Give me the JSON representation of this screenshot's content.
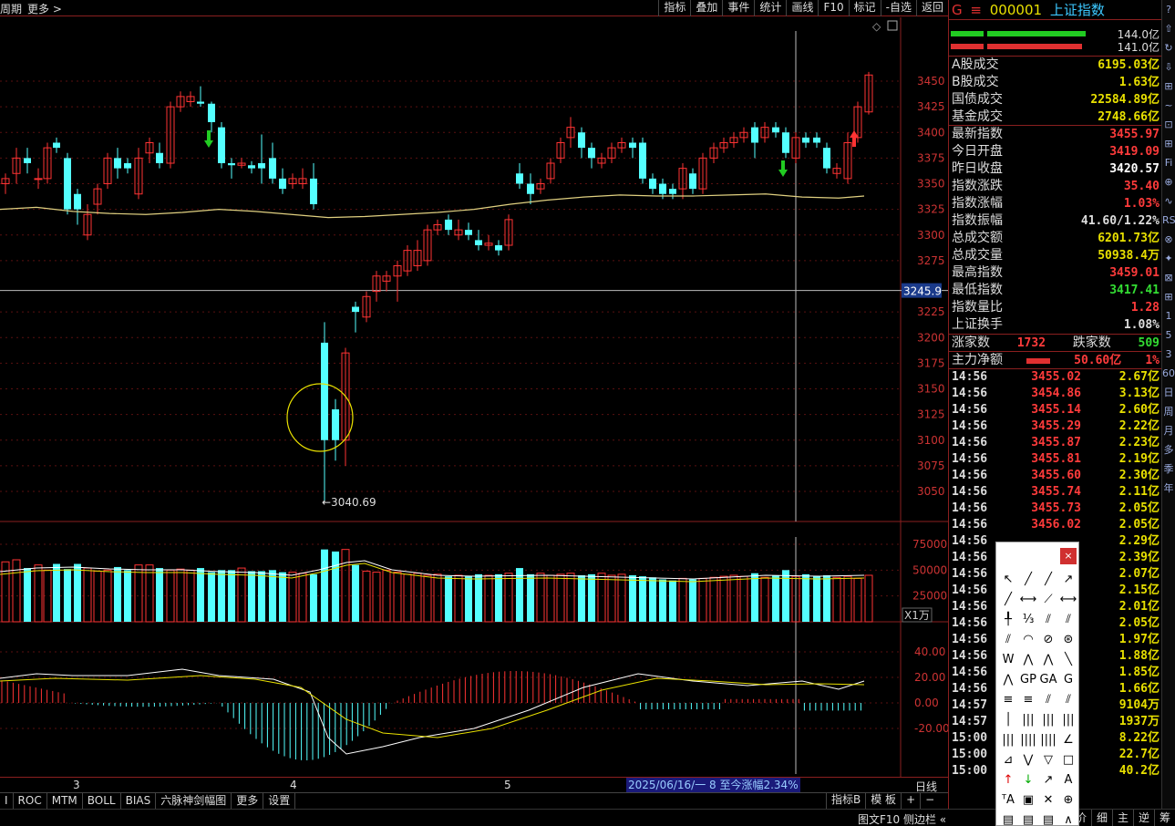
{
  "topbar": {
    "left": [
      "周期",
      "更多 >"
    ],
    "buttons": [
      "指标",
      "叠加",
      "事件",
      "统计",
      "画线",
      "F10",
      "标记",
      "-自选",
      "返回"
    ]
  },
  "price_chart": {
    "y_ticks": [
      "3450",
      "3425",
      "3400",
      "3375",
      "3350",
      "3325",
      "3300",
      "3275",
      "3245.9",
      "3225",
      "3200",
      "3175",
      "3150",
      "3125",
      "3100",
      "3075",
      "3050"
    ],
    "low_label": "←3040.69",
    "crosshair_price": "3245.9"
  },
  "volume_chart": {
    "y_ticks": [
      "75000",
      "50000",
      "25000"
    ],
    "unit": "X1万"
  },
  "macd_chart": {
    "y_ticks": [
      "40.00",
      "20.00",
      "0.00",
      "-20.00"
    ]
  },
  "x_axis": {
    "months": [
      "3",
      "4",
      "5"
    ],
    "hint": "2025/06/16/一 8 至今涨幅2.34%",
    "right": "日线"
  },
  "tabs": [
    "I",
    "ROC",
    "MTM",
    "BOLL",
    "BIAS",
    "六脉神剑幅图",
    "更多",
    "设置"
  ],
  "tabs_right": [
    "指标B",
    "模 板",
    "+",
    "−"
  ],
  "status": {
    "left": "图文F10 侧边栏 «",
    "right": [
      "笔",
      "价",
      "细",
      "主",
      "逆",
      "筹"
    ]
  },
  "header": {
    "g": "G",
    "menu": "≡",
    "code": "000001",
    "name": "上证指数"
  },
  "flow_bars": {
    "up": "144.0亿",
    "down": "141.0亿"
  },
  "stats": [
    {
      "k": "A股成交",
      "v": "6195.03亿",
      "c": "#e8e000"
    },
    {
      "k": "B股成交",
      "v": "1.63亿",
      "c": "#e8e000"
    },
    {
      "k": "国债成交",
      "v": "22584.89亿",
      "c": "#e8e000"
    },
    {
      "k": "基金成交",
      "v": "2748.66亿",
      "c": "#e8e000"
    },
    {
      "k": "最新指数",
      "v": "3455.97",
      "c": "#ff3b3b"
    },
    {
      "k": "今日开盘",
      "v": "3419.09",
      "c": "#ff3b3b"
    },
    {
      "k": "昨日收盘",
      "v": "3420.57",
      "c": "#ffffff"
    },
    {
      "k": "指数涨跌",
      "v": "35.40",
      "c": "#ff3b3b"
    },
    {
      "k": "指数涨幅",
      "v": "1.03%",
      "c": "#ff3b3b"
    },
    {
      "k": "指数振幅",
      "v": "41.60/1.22%",
      "c": "#dddddd"
    },
    {
      "k": "总成交额",
      "v": "6201.73亿",
      "c": "#e8e000"
    },
    {
      "k": "总成交量",
      "v": "50938.4万",
      "c": "#e8e000"
    },
    {
      "k": "最高指数",
      "v": "3459.01",
      "c": "#ff3b3b"
    },
    {
      "k": "最低指数",
      "v": "3417.41",
      "c": "#33dd33"
    },
    {
      "k": "指数量比",
      "v": "1.28",
      "c": "#ff3b3b"
    },
    {
      "k": "上证换手",
      "v": "1.08%",
      "c": "#dddddd"
    }
  ],
  "breadth": {
    "up_label": "涨家数",
    "up": "1732",
    "down_label": "跌家数",
    "down": "509"
  },
  "mainflow": {
    "label": "主力净额",
    "value": "50.60亿",
    "pct": "1%"
  },
  "ticks": [
    [
      "14:56",
      "3455.02",
      "2.67亿"
    ],
    [
      "14:56",
      "3454.86",
      "3.13亿"
    ],
    [
      "14:56",
      "3455.14",
      "2.60亿"
    ],
    [
      "14:56",
      "3455.29",
      "2.22亿"
    ],
    [
      "14:56",
      "3455.87",
      "2.23亿"
    ],
    [
      "14:56",
      "3455.81",
      "2.19亿"
    ],
    [
      "14:56",
      "3455.60",
      "2.30亿"
    ],
    [
      "14:56",
      "3455.74",
      "2.11亿"
    ],
    [
      "14:56",
      "3455.73",
      "2.05亿"
    ],
    [
      "14:56",
      "3456.02",
      "2.05亿"
    ],
    [
      "14:56",
      "",
      "2.29亿"
    ],
    [
      "14:56",
      "",
      "2.39亿"
    ],
    [
      "14:56",
      "",
      "2.07亿"
    ],
    [
      "14:56",
      "",
      "2.15亿"
    ],
    [
      "14:56",
      "",
      "2.01亿"
    ],
    [
      "14:56",
      "",
      "2.05亿"
    ],
    [
      "14:56",
      "",
      "1.97亿"
    ],
    [
      "14:56",
      "",
      "1.88亿"
    ],
    [
      "14:56",
      "",
      "1.85亿"
    ],
    [
      "14:56",
      "",
      "1.66亿"
    ],
    [
      "14:57",
      "",
      "9104万"
    ],
    [
      "14:57",
      "",
      "1937万"
    ],
    [
      "15:00",
      "",
      "8.22亿"
    ],
    [
      "15:00",
      "",
      "22.7亿"
    ],
    [
      "15:00",
      "",
      "40.2亿"
    ]
  ],
  "right_toolbar": [
    "?",
    "⇧",
    "↻",
    "⇩",
    "⊞",
    "~",
    "⊡",
    "⊞",
    "Fi",
    "⊕",
    "∿",
    "RS",
    "⊗",
    "✦",
    "⊠",
    "⊞",
    "1",
    "5",
    "3",
    "60",
    "日",
    "周",
    "月",
    "多",
    "季",
    "年"
  ]
}
